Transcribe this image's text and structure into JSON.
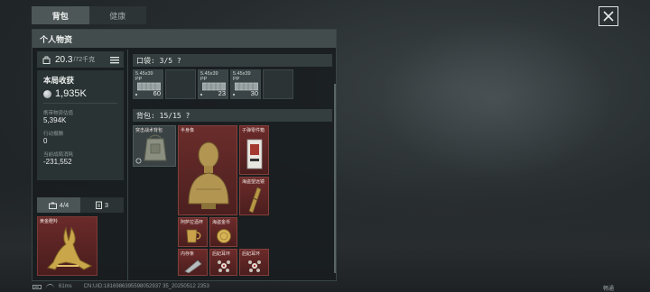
{
  "tabs": [
    {
      "label": "背包",
      "active": true
    },
    {
      "label": "健康",
      "active": false
    }
  ],
  "panel": {
    "title": "个人物资",
    "weight": {
      "current": "20.3",
      "max": "/72千克"
    },
    "stats": {
      "round_income_label": "本局收获",
      "round_income_value": "1,935K",
      "carried_value_label": "携带物资估值",
      "carried_value": "5,394K",
      "action_reward_label": "行动报酬",
      "action_reward": "0",
      "current_consumption_label": "当前战局消耗",
      "current_consumption": "-231,552"
    },
    "lower_tabs": [
      {
        "label": "4/4",
        "icon": "equipment-icon",
        "active": true
      },
      {
        "label": "3",
        "icon": "case-icon",
        "active": false
      }
    ],
    "equip_slot_name": "黄金瞪羚"
  },
  "pocket": {
    "header": "口袋: 3/5 ?",
    "cells": [
      {
        "label": "5.45x39",
        "sub": "PP",
        "count": "60"
      },
      {
        "label": "",
        "sub": "",
        "count": ""
      },
      {
        "label": "5.45x39",
        "sub": "PP",
        "count": "23"
      },
      {
        "label": "5.45x39",
        "sub": "PP",
        "count": "30"
      },
      {
        "label": "",
        "sub": "",
        "count": ""
      }
    ]
  },
  "backpack": {
    "header": "背包: 15/15 ?",
    "items": {
      "pack": "突击战术背包",
      "bust": "半身像",
      "cartridge": "子弹零件箱",
      "telescope": "海盗望远镜",
      "cup": "阿萨拉酒杯",
      "coin": "海盗金币",
      "ingot": "内存条",
      "earring1": "后妃耳环",
      "earring2": "后妃耳环"
    }
  },
  "statusbar": {
    "ping": "61ms",
    "cn_uid": "CN:UID:1816986395598052937 35_20250512 2353"
  },
  "speed_badge": "畅通",
  "colors": {
    "accent_red": "#6a2a2a",
    "panel_header": "#434c4d",
    "active_tab": "#4d5757"
  }
}
